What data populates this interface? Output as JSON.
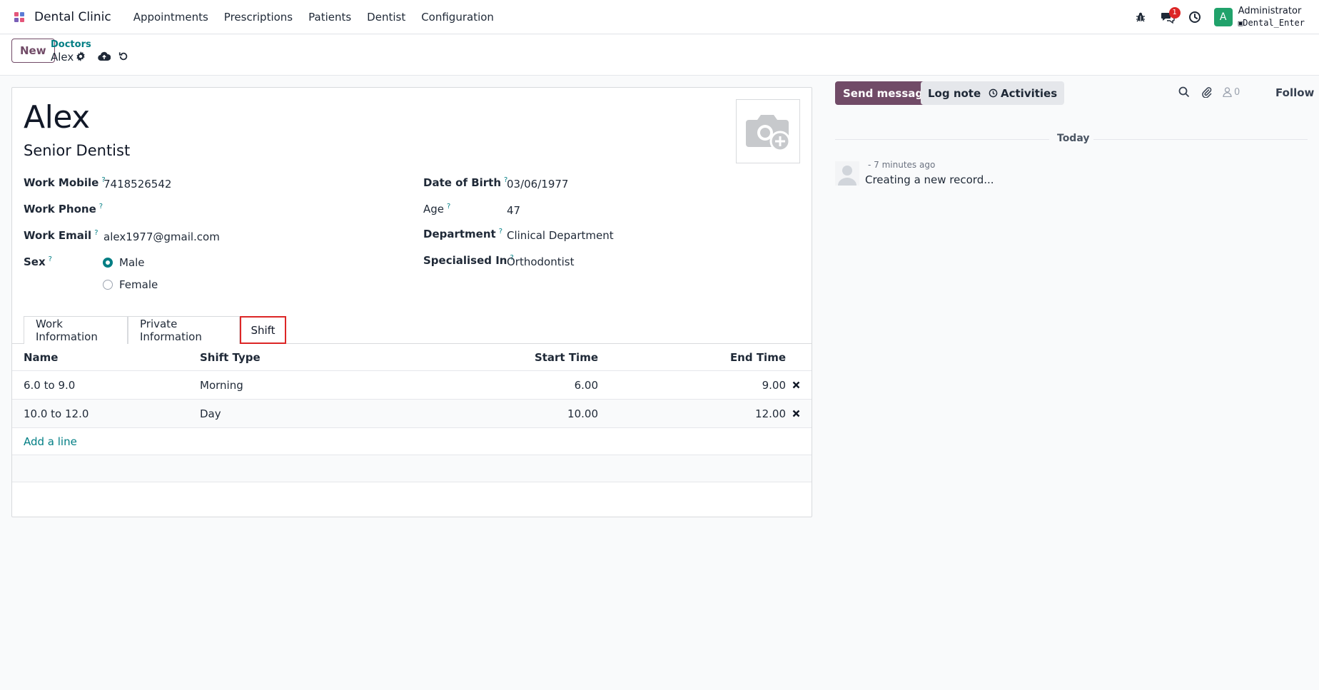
{
  "navbar": {
    "brand": "Dental Clinic",
    "menu": [
      "Appointments",
      "Prescriptions",
      "Patients",
      "Dentist",
      "Configuration"
    ],
    "messages_badge": "1",
    "avatar_letter": "A",
    "user_name": "Administrator",
    "database": "Dental_Enter"
  },
  "control": {
    "new_label": "New",
    "breadcrumb": "Doctors",
    "record_name": "Alex"
  },
  "form": {
    "name": "Alex",
    "job_title": "Senior Dentist",
    "left_fields": [
      {
        "label": "Work Mobile",
        "value": "7418526542"
      },
      {
        "label": "Work Phone",
        "value": ""
      },
      {
        "label": "Work Email",
        "value": "alex1977@gmail.com"
      },
      {
        "label": "Sex",
        "value": ""
      }
    ],
    "sex_options": [
      {
        "label": "Male",
        "selected": true
      },
      {
        "label": "Female",
        "selected": false
      }
    ],
    "right_fields": [
      {
        "label": "Date of Birth",
        "value": "03/06/1977"
      },
      {
        "label": "Age",
        "value": "47"
      },
      {
        "label": "Department",
        "value": "Clinical Department"
      },
      {
        "label": "Specialised In",
        "value": "Orthodontist"
      }
    ],
    "help_mark": "?"
  },
  "tabs": [
    {
      "label": "Work Information",
      "active": false
    },
    {
      "label": "Private Information",
      "active": false
    },
    {
      "label": "Shift",
      "active": true
    }
  ],
  "shift_table": {
    "headers": {
      "name": "Name",
      "type": "Shift Type",
      "start": "Start Time",
      "end": "End Time"
    },
    "rows": [
      {
        "name": "6.0 to 9.0",
        "type": "Morning",
        "start": "6.00",
        "end": "9.00"
      },
      {
        "name": "10.0 to 12.0",
        "type": "Day",
        "start": "10.00",
        "end": "12.00"
      }
    ],
    "add_line": "Add a line"
  },
  "chatter": {
    "send_message": "Send message",
    "log_note": "Log note",
    "activities": "Activities",
    "followers_count": "0",
    "follow": "Follow",
    "today": "Today",
    "message_time": "- 7 minutes ago",
    "message_body": "Creating a new record..."
  },
  "colors": {
    "brand": "#714b67",
    "accent": "#017e84",
    "highlight": "#dc2626"
  }
}
